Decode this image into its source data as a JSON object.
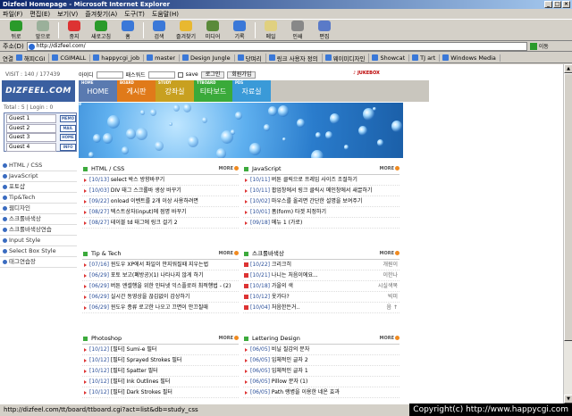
{
  "window": {
    "title": "Dizfeel Homepage - Microsoft Internet Explorer"
  },
  "menu": [
    "파일(F)",
    "편집(E)",
    "보기(V)",
    "즐겨찾기(A)",
    "도구(T)",
    "도움말(H)"
  ],
  "toolbar": [
    {
      "label": "뒤로",
      "icon": "back-arrow-icon",
      "color": "#2a9a2a"
    },
    {
      "label": "앞으로",
      "icon": "forward-arrow-icon",
      "color": "#9ab09a"
    },
    {
      "label": "중지",
      "icon": "stop-icon",
      "color": "#d33"
    },
    {
      "label": "새로고침",
      "icon": "refresh-icon",
      "color": "#2a9a2a"
    },
    {
      "label": "홈",
      "icon": "home-icon",
      "color": "#3a78d8"
    },
    {
      "label": "검색",
      "icon": "search-icon",
      "color": "#3a78d8"
    },
    {
      "label": "즐겨찾기",
      "icon": "favorites-icon",
      "color": "#e8b830"
    },
    {
      "label": "미디어",
      "icon": "media-icon",
      "color": "#5a8a3a"
    },
    {
      "label": "기록",
      "icon": "history-icon",
      "color": "#3a78d8"
    },
    {
      "label": "메일",
      "icon": "mail-icon",
      "color": "#e0d080"
    },
    {
      "label": "인쇄",
      "icon": "print-icon",
      "color": "#888"
    },
    {
      "label": "편집",
      "icon": "edit-icon",
      "color": "#5a7ac8"
    }
  ],
  "address": {
    "label": "주소(D)",
    "value": "http://dizfeel.com/",
    "go": "이동"
  },
  "links": {
    "label": "연결",
    "items": [
      "해피CGI",
      "CGIMALL",
      "happycgi_job",
      "master",
      "Design Jungle",
      "당며리",
      "링크 사용자 정의",
      "웨이미디자인",
      "Showcat",
      "TJ art",
      "Windows Media"
    ]
  },
  "site": {
    "visit": "VISIT : 140 / 177439",
    "logo": "DIZFEEL.COM",
    "login": {
      "id_label": "아이디",
      "pw_label": "패스워드",
      "save": "save",
      "login_btn": "로그인",
      "join_btn": "회원가입"
    },
    "jukebox": "JUKEBOX",
    "nav": [
      {
        "label": "HOME",
        "sub": "HOME",
        "color": "#5a7ab0"
      },
      {
        "label": "게시판",
        "sub": "BOARD",
        "color": "#e07a1a"
      },
      {
        "label": "강좌실",
        "sub": "STUDY",
        "color": "#c8a020"
      },
      {
        "label": "티타보드",
        "sub": "TTBOARD",
        "color": "#3aaa3a"
      },
      {
        "label": "자료실",
        "sub": "PDS",
        "color": "#3a9ad8"
      }
    ],
    "total": "Total : 5 | Login : 0",
    "guests": [
      "Guest 1",
      "Guest 2",
      "Guest 3",
      "Guest 4"
    ],
    "guest_buttons": [
      "MEMO",
      "MAIL",
      "HOME",
      "INFO"
    ],
    "sidemenu": [
      "HTML / CSS",
      "JavaScript",
      "포토샵",
      "Tip&Tech",
      "웹디자인",
      "스크롤바색상",
      "스크롤바색상연습",
      "Input Style",
      "Select Box Style",
      "태그연습장"
    ],
    "more": "MORE",
    "sections": [
      {
        "title": "HTML / CSS",
        "rows": [
          {
            "date": "[10/13]",
            "text": " select 박스 방향바꾸기"
          },
          {
            "date": "[10/03]",
            "text": " DIV 태그 스크롤바 생상 바꾸기"
          },
          {
            "date": "[09/22]",
            "text": " onload 이벤트를 2개 이상 사용하려면"
          },
          {
            "date": "[08/27]",
            "text": " 텍스트상자(input)에 점명 바꾸기"
          },
          {
            "date": "[08/27]",
            "text": " 테이블 td 태그에 링크 걸기 2"
          }
        ]
      },
      {
        "title": "JavaScript",
        "rows": [
          {
            "date": "[10/11]",
            "text": " 버튼 클릭으로 프레임 사이즈 조절하기"
          },
          {
            "date": "[10/11]",
            "text": " 팝업창에서 링크 클릭시 메인창에서 새끌하기"
          },
          {
            "date": "[10/02]",
            "text": " 마우스를 올리면 간단한 설명을 보여주기"
          },
          {
            "date": "[10/01]",
            "text": " 폼(form) 타겟 지정하기"
          },
          {
            "date": "[09/18]",
            "text": " 메뉴 1 (가로)"
          }
        ]
      },
      {
        "title": "Tip & Tech",
        "rows": [
          {
            "date": "[07/16]",
            "text": " 윈도우 XP에서 파일이 안지워질때 지우는법"
          },
          {
            "date": "[06/29]",
            "text": " 포토 보고(폐방공)(1) 나타나지 않게 하기"
          },
          {
            "date": "[06/29]",
            "text": " 버튼 엔셀행을 위한 인터넷 익스플로러 최적행법 - (2)"
          },
          {
            "date": "[06/29]",
            "text": " 실시간 동영상을 끊김없이 감상하기"
          },
          {
            "date": "[06/29]",
            "text": " 윈도우 종류 로고한 나오고 끄면이 안끄질때"
          }
        ]
      },
      {
        "title": "스크롤바색상",
        "rows": [
          {
            "date": "[10/22]",
            "text": " 크리크히",
            "name": "개원이"
          },
          {
            "date": "[10/21]",
            "text": " 나니는 처음이에요...",
            "name": "이한나"
          },
          {
            "date": "[10/18]",
            "text": " 가을의 색",
            "name": "시실색목"
          },
          {
            "date": "[10/12]",
            "text": " 옷가다?",
            "name": "빅미"
          },
          {
            "date": "[10/04]",
            "text": " 처음한든거..",
            "name": "음 ↑"
          }
        ]
      },
      {
        "title": "Photoshop",
        "rows": [
          {
            "date": "[10/12]",
            "text": " [필터] Sumi-e 필터"
          },
          {
            "date": "[10/12]",
            "text": " [필터] Sprayed Strokes 필터"
          },
          {
            "date": "[10/12]",
            "text": " [필터] Spatter 필터"
          },
          {
            "date": "[10/12]",
            "text": " [필터] Ink Outlines 필터"
          },
          {
            "date": "[10/12]",
            "text": " [필터] Dark Strokes 필터"
          }
        ]
      },
      {
        "title": "Lettering Design",
        "rows": [
          {
            "date": "[06/05]",
            "text": " 비닐 질감의 문자"
          },
          {
            "date": "[06/05]",
            "text": " 입체적인 글자 2"
          },
          {
            "date": "[06/05]",
            "text": " 입체적인 글자 1"
          },
          {
            "date": "[06/05]",
            "text": " Pillow 문자 (1)"
          },
          {
            "date": "[06/05]",
            "text": " Path 랭병을 이용한 네온 효과"
          }
        ]
      }
    ]
  },
  "status": {
    "url": "http://dizfeel.com/tt/board/ttboard.cgi?act=list&db=study_css",
    "copyright": "Copyright(c) http://www.happycgi.com"
  }
}
